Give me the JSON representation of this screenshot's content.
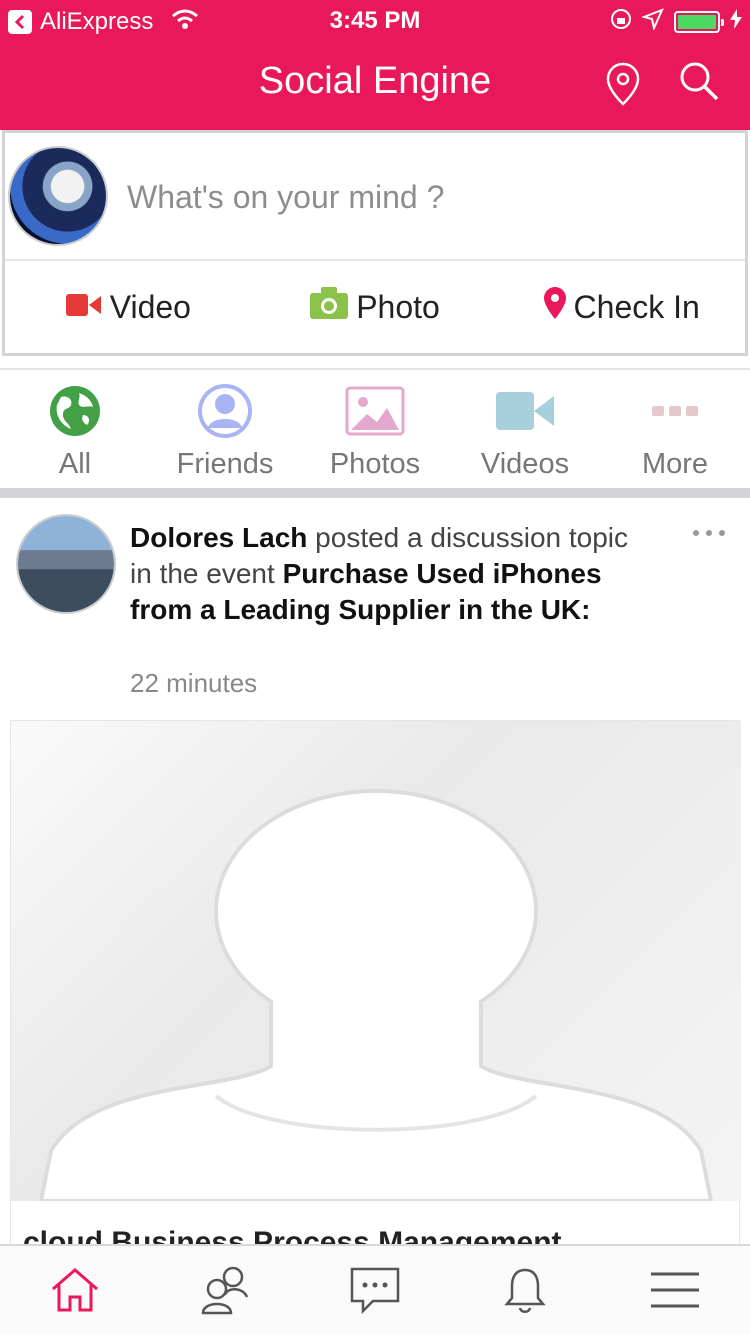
{
  "status_bar": {
    "back_app": "AliExpress",
    "time": "3:45 PM"
  },
  "nav": {
    "title": "Social Engine",
    "location_icon": "map-pin-icon",
    "search_icon": "search-icon"
  },
  "composer": {
    "placeholder": "What's on your mind ?",
    "actions": [
      {
        "label": "Video",
        "icon": "video-icon",
        "color": "#e53935"
      },
      {
        "label": "Photo",
        "icon": "camera-icon",
        "color": "#8bc34a"
      },
      {
        "label": "Check In",
        "icon": "map-pin-icon",
        "color": "#e8185a"
      }
    ]
  },
  "filters": [
    {
      "label": "All",
      "icon": "globe-icon"
    },
    {
      "label": "Friends",
      "icon": "person-icon"
    },
    {
      "label": "Photos",
      "icon": "image-icon"
    },
    {
      "label": "Videos",
      "icon": "video-icon"
    },
    {
      "label": "More",
      "icon": "more-icon"
    }
  ],
  "post": {
    "author": "Dolores Lach",
    "action_text": " posted a discussion topic in the event ",
    "event": "Purchase Used iPhones from a Leading Supplier in the UK:",
    "time": "22 minutes",
    "card_title": "cloud Business Process Management"
  },
  "tabbar": [
    {
      "name": "home",
      "icon": "home-icon",
      "active": true
    },
    {
      "name": "friends",
      "icon": "people-icon"
    },
    {
      "name": "messages",
      "icon": "chat-icon"
    },
    {
      "name": "notifications",
      "icon": "bell-icon"
    },
    {
      "name": "menu",
      "icon": "menu-icon"
    }
  ],
  "colors": {
    "brand": "#e8185a",
    "divider": "#d4d4d8"
  }
}
